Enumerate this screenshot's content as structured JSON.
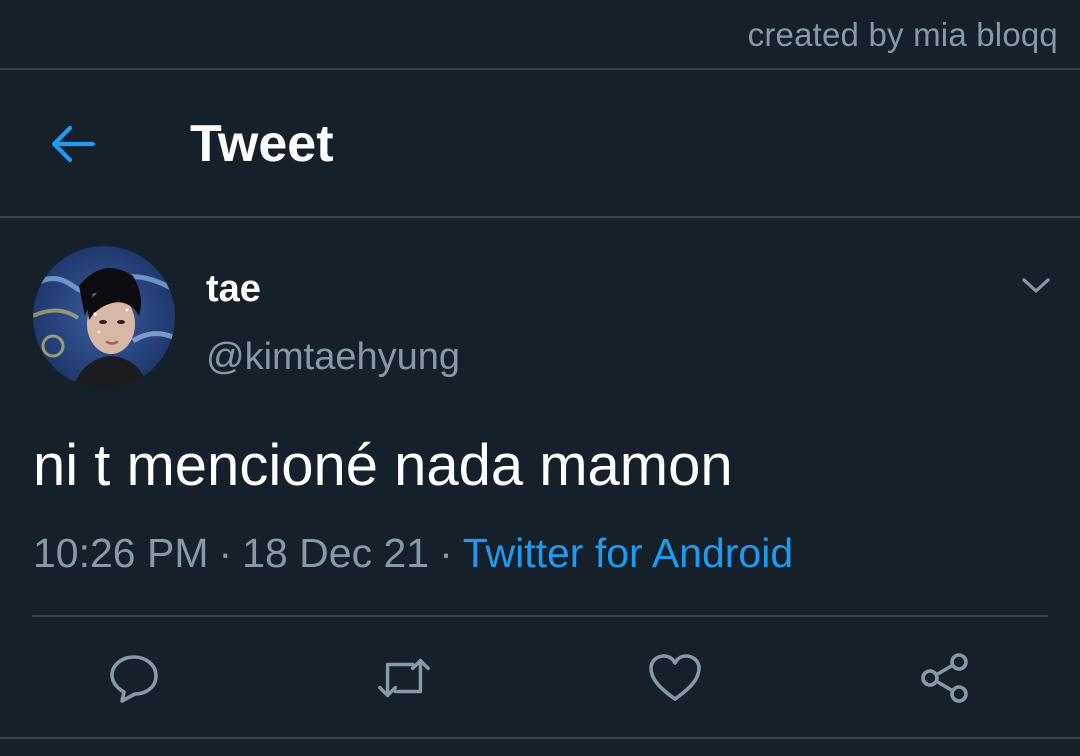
{
  "watermark": "created by mia bloqq",
  "header": {
    "title": "Tweet",
    "back_icon": "arrow-left-icon",
    "accent": "#1d9bf0"
  },
  "tweet": {
    "display_name": "tae",
    "handle": "@kimtaehyung",
    "text": "ni t mencioné nada mamon",
    "time": "10:26 PM",
    "date": "18 Dec 21",
    "separator": "·",
    "source": "Twitter for Android",
    "menu_icon": "chevron-down-icon"
  },
  "actions": [
    {
      "name": "reply",
      "icon": "comment-icon"
    },
    {
      "name": "retweet",
      "icon": "retweet-icon"
    },
    {
      "name": "like",
      "icon": "heart-icon"
    },
    {
      "name": "share",
      "icon": "share-icon"
    }
  ],
  "colors": {
    "background": "#15202b",
    "divider": "#38444d",
    "secondary_text": "#8899a6",
    "link": "#1d9bf0"
  }
}
